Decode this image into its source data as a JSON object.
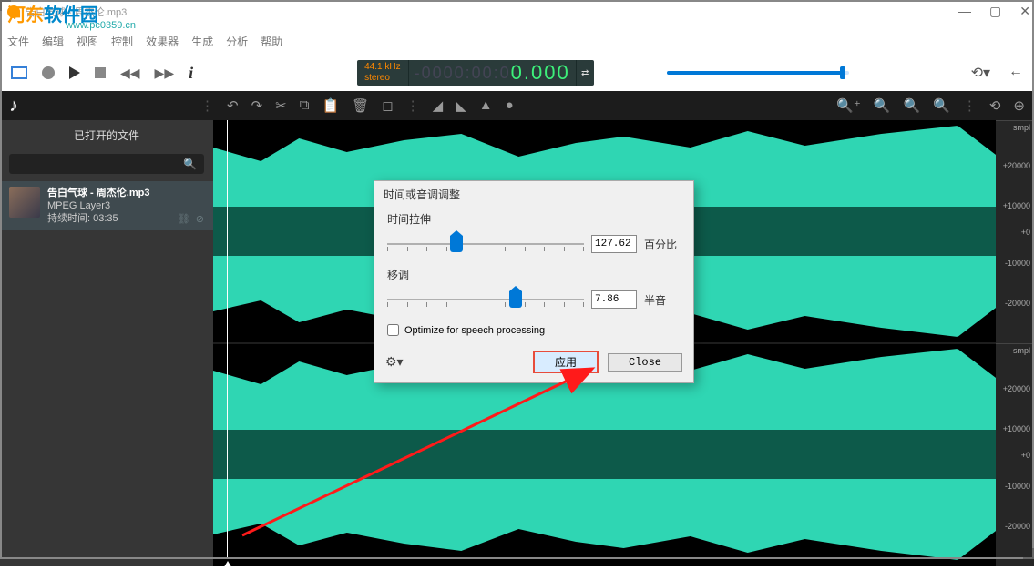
{
  "window": {
    "title": "告白气球 - 周杰伦.mp3"
  },
  "watermark": {
    "text": "河东软件园",
    "url": "www.pc0359.cn"
  },
  "menu": {
    "file": "文件",
    "edit": "编辑",
    "view": "视图",
    "control": "控制",
    "effects": "效果器",
    "generate": "生成",
    "analyze": "分析",
    "help": "帮助"
  },
  "counter": {
    "freq": "44.1 kHz",
    "channels": "stereo",
    "dim_digits": "-0000:00:0",
    "bright_digits": "0.000"
  },
  "sidebar": {
    "header": "已打开的文件",
    "file": {
      "name": "告白气球 - 周杰伦.mp3",
      "codec": "MPEG Layer3",
      "duration_label": "持续时间:",
      "duration": "03:35"
    }
  },
  "ruler": {
    "labels": [
      "smpl",
      "+20000",
      "+10000",
      "+0",
      "-10000",
      "-20000",
      "smpl",
      "+20000",
      "+10000",
      "+0",
      "-10000",
      "-20000"
    ]
  },
  "dialog": {
    "title": "时间或音调调整",
    "stretch_label": "时间拉伸",
    "stretch_value": "127.62",
    "stretch_unit": "百分比",
    "pitch_label": "移调",
    "pitch_value": "7.86",
    "pitch_unit": "半音",
    "optimize_label": "Optimize for speech processing",
    "apply": "应用",
    "close": "Close"
  }
}
